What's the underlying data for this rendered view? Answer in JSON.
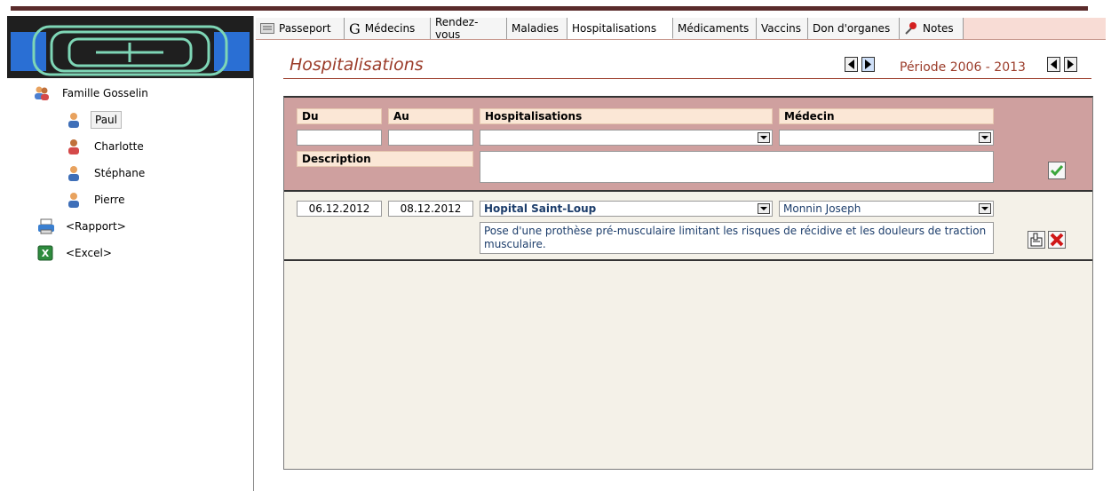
{
  "sidebar": {
    "family": "Famille Gosselin",
    "members": [
      "Paul",
      "Charlotte",
      "Stéphane",
      "Pierre"
    ],
    "selected": "Paul",
    "report": "<Rapport>",
    "excel": "<Excel>"
  },
  "tabs": [
    {
      "label": "Passeport",
      "icon": "passport-icon"
    },
    {
      "label": "Médecins",
      "icon": "g-icon"
    },
    {
      "label": "Rendez-vous"
    },
    {
      "label": "Maladies"
    },
    {
      "label": "Hospitalisations",
      "active": true
    },
    {
      "label": "Médicaments"
    },
    {
      "label": "Vaccins"
    },
    {
      "label": "Don d'organes"
    },
    {
      "label": "Notes",
      "icon": "pin-icon"
    }
  ],
  "header": {
    "title": "Hospitalisations",
    "periode": "Période 2006 - 2013"
  },
  "form": {
    "du_label": "Du",
    "au_label": "Au",
    "hosp_label": "Hospitalisations",
    "medecin_label": "Médecin",
    "description_label": "Description",
    "du_value": "",
    "au_value": "",
    "hosp_value": "",
    "medecin_value": "",
    "description_value": ""
  },
  "records": [
    {
      "du": "06.12.2012",
      "au": "08.12.2012",
      "hospital": "Hopital Saint-Loup",
      "medecin": "Monnin Joseph",
      "description": "Pose d'une prothèse pré-musculaire  limitant les risques de récidive et les douleurs de traction musculaire."
    }
  ],
  "colors": {
    "accent": "#9b3c2a",
    "form_bg": "#cfa09f",
    "tab_bg": "#f8dcd5",
    "panel_bg": "#f4f1e8"
  }
}
